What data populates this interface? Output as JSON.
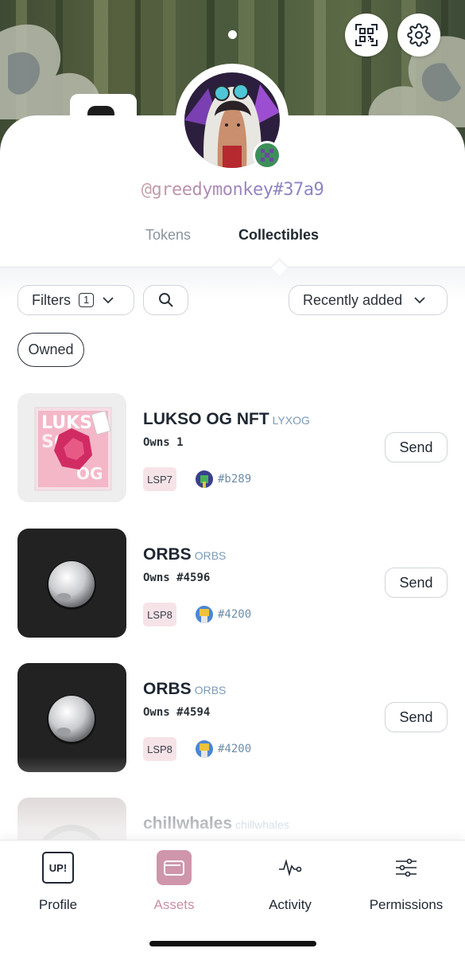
{
  "profile": {
    "handle": "@greedymonkey",
    "hash": "#37a9"
  },
  "tabs": [
    {
      "label": "Tokens",
      "active": false
    },
    {
      "label": "Collectibles",
      "active": true
    }
  ],
  "toolbar": {
    "filters_label": "Filters",
    "filters_count": "1",
    "sort_label": "Recently added",
    "owned_chip": "Owned"
  },
  "assets": [
    {
      "name": "LUKSO OG NFT",
      "symbol": "LYXOG",
      "owns_label": "Owns",
      "owns_value": "1",
      "standard": "LSP7",
      "creator": "#b289",
      "send_label": "Send"
    },
    {
      "name": "ORBS",
      "symbol": "ORBS",
      "owns_label": "Owns",
      "owns_value": "#4596",
      "standard": "LSP8",
      "creator": "#4200",
      "send_label": "Send"
    },
    {
      "name": "ORBS",
      "symbol": "ORBS",
      "owns_label": "Owns",
      "owns_value": "#4594",
      "standard": "LSP8",
      "creator": "#4200",
      "send_label": "Send"
    },
    {
      "name": "chillwhales",
      "symbol": "chillwhales"
    }
  ],
  "thumb_text": {
    "og_line1": "LUKS",
    "og_line2": "SO O",
    "og_line3": "OG"
  },
  "nav": {
    "profile_badge": "UP!",
    "items": [
      {
        "label": "Profile",
        "icon": "up-badge-icon"
      },
      {
        "label": "Assets",
        "icon": "wallet-icon",
        "active": true
      },
      {
        "label": "Activity",
        "icon": "pulse-icon"
      },
      {
        "label": "Permissions",
        "icon": "sliders-icon"
      }
    ]
  },
  "colors": {
    "accent": "#c98fa5",
    "lsp_badge_bg": "#f6e3e7",
    "symbol": "#7b9ab5"
  }
}
